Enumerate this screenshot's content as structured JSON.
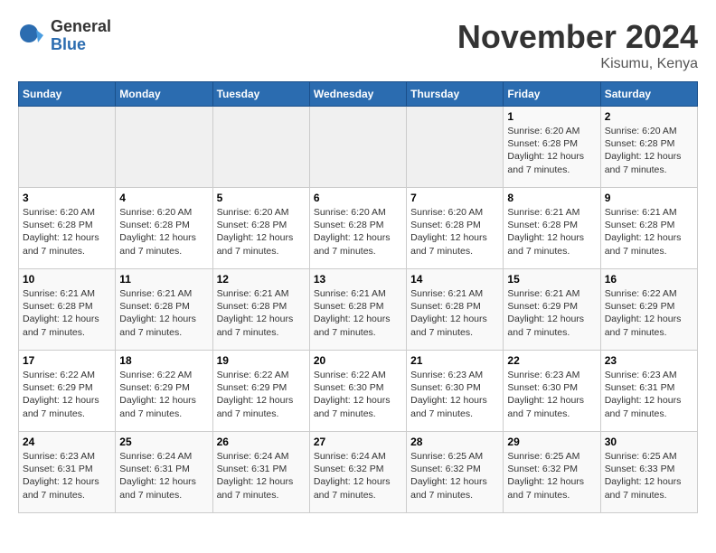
{
  "logo": {
    "general": "General",
    "blue": "Blue"
  },
  "title": "November 2024",
  "location": "Kisumu, Kenya",
  "days_header": [
    "Sunday",
    "Monday",
    "Tuesday",
    "Wednesday",
    "Thursday",
    "Friday",
    "Saturday"
  ],
  "weeks": [
    [
      {
        "day": "",
        "info": ""
      },
      {
        "day": "",
        "info": ""
      },
      {
        "day": "",
        "info": ""
      },
      {
        "day": "",
        "info": ""
      },
      {
        "day": "",
        "info": ""
      },
      {
        "day": "1",
        "info": "Sunrise: 6:20 AM\nSunset: 6:28 PM\nDaylight: 12 hours and 7 minutes."
      },
      {
        "day": "2",
        "info": "Sunrise: 6:20 AM\nSunset: 6:28 PM\nDaylight: 12 hours and 7 minutes."
      }
    ],
    [
      {
        "day": "3",
        "info": "Sunrise: 6:20 AM\nSunset: 6:28 PM\nDaylight: 12 hours and 7 minutes."
      },
      {
        "day": "4",
        "info": "Sunrise: 6:20 AM\nSunset: 6:28 PM\nDaylight: 12 hours and 7 minutes."
      },
      {
        "day": "5",
        "info": "Sunrise: 6:20 AM\nSunset: 6:28 PM\nDaylight: 12 hours and 7 minutes."
      },
      {
        "day": "6",
        "info": "Sunrise: 6:20 AM\nSunset: 6:28 PM\nDaylight: 12 hours and 7 minutes."
      },
      {
        "day": "7",
        "info": "Sunrise: 6:20 AM\nSunset: 6:28 PM\nDaylight: 12 hours and 7 minutes."
      },
      {
        "day": "8",
        "info": "Sunrise: 6:21 AM\nSunset: 6:28 PM\nDaylight: 12 hours and 7 minutes."
      },
      {
        "day": "9",
        "info": "Sunrise: 6:21 AM\nSunset: 6:28 PM\nDaylight: 12 hours and 7 minutes."
      }
    ],
    [
      {
        "day": "10",
        "info": "Sunrise: 6:21 AM\nSunset: 6:28 PM\nDaylight: 12 hours and 7 minutes."
      },
      {
        "day": "11",
        "info": "Sunrise: 6:21 AM\nSunset: 6:28 PM\nDaylight: 12 hours and 7 minutes."
      },
      {
        "day": "12",
        "info": "Sunrise: 6:21 AM\nSunset: 6:28 PM\nDaylight: 12 hours and 7 minutes."
      },
      {
        "day": "13",
        "info": "Sunrise: 6:21 AM\nSunset: 6:28 PM\nDaylight: 12 hours and 7 minutes."
      },
      {
        "day": "14",
        "info": "Sunrise: 6:21 AM\nSunset: 6:28 PM\nDaylight: 12 hours and 7 minutes."
      },
      {
        "day": "15",
        "info": "Sunrise: 6:21 AM\nSunset: 6:29 PM\nDaylight: 12 hours and 7 minutes."
      },
      {
        "day": "16",
        "info": "Sunrise: 6:22 AM\nSunset: 6:29 PM\nDaylight: 12 hours and 7 minutes."
      }
    ],
    [
      {
        "day": "17",
        "info": "Sunrise: 6:22 AM\nSunset: 6:29 PM\nDaylight: 12 hours and 7 minutes."
      },
      {
        "day": "18",
        "info": "Sunrise: 6:22 AM\nSunset: 6:29 PM\nDaylight: 12 hours and 7 minutes."
      },
      {
        "day": "19",
        "info": "Sunrise: 6:22 AM\nSunset: 6:29 PM\nDaylight: 12 hours and 7 minutes."
      },
      {
        "day": "20",
        "info": "Sunrise: 6:22 AM\nSunset: 6:30 PM\nDaylight: 12 hours and 7 minutes."
      },
      {
        "day": "21",
        "info": "Sunrise: 6:23 AM\nSunset: 6:30 PM\nDaylight: 12 hours and 7 minutes."
      },
      {
        "day": "22",
        "info": "Sunrise: 6:23 AM\nSunset: 6:30 PM\nDaylight: 12 hours and 7 minutes."
      },
      {
        "day": "23",
        "info": "Sunrise: 6:23 AM\nSunset: 6:31 PM\nDaylight: 12 hours and 7 minutes."
      }
    ],
    [
      {
        "day": "24",
        "info": "Sunrise: 6:23 AM\nSunset: 6:31 PM\nDaylight: 12 hours and 7 minutes."
      },
      {
        "day": "25",
        "info": "Sunrise: 6:24 AM\nSunset: 6:31 PM\nDaylight: 12 hours and 7 minutes."
      },
      {
        "day": "26",
        "info": "Sunrise: 6:24 AM\nSunset: 6:31 PM\nDaylight: 12 hours and 7 minutes."
      },
      {
        "day": "27",
        "info": "Sunrise: 6:24 AM\nSunset: 6:32 PM\nDaylight: 12 hours and 7 minutes."
      },
      {
        "day": "28",
        "info": "Sunrise: 6:25 AM\nSunset: 6:32 PM\nDaylight: 12 hours and 7 minutes."
      },
      {
        "day": "29",
        "info": "Sunrise: 6:25 AM\nSunset: 6:32 PM\nDaylight: 12 hours and 7 minutes."
      },
      {
        "day": "30",
        "info": "Sunrise: 6:25 AM\nSunset: 6:33 PM\nDaylight: 12 hours and 7 minutes."
      }
    ]
  ]
}
